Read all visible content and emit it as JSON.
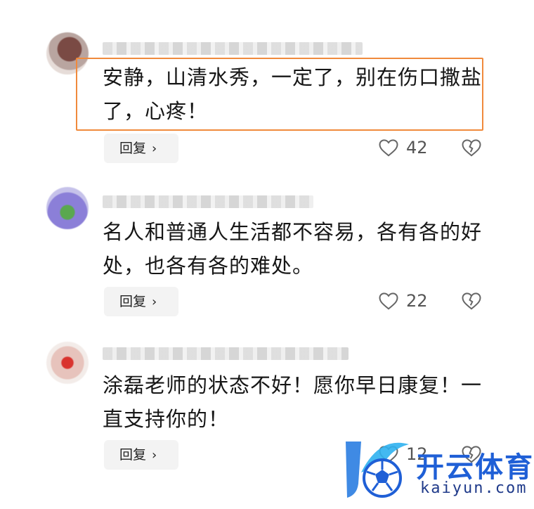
{
  "comments": [
    {
      "text": "安静，山清水秀，一定了，别在伤口撒盐了，心疼！",
      "reply_label": "回复",
      "likes": "42"
    },
    {
      "text": "名人和普通人生活都不容易，各有各的好处，也各有各的难处。",
      "reply_label": "回复",
      "likes": "22"
    },
    {
      "text": "涂磊老师的状态不好！愿你早日康复！一直支持你的！",
      "reply_label": "回复",
      "likes": "12"
    }
  ],
  "watermark": {
    "title": "开云体育",
    "subtitle": "kaiyun.com"
  },
  "colors": {
    "highlight": "#f08a3c",
    "brand": "#1f5fd6"
  }
}
